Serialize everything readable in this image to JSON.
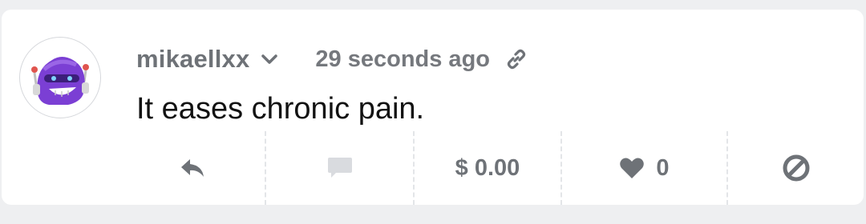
{
  "post": {
    "username": "mikaellxx",
    "timestamp": "29 seconds ago",
    "body": "It eases chronic pain."
  },
  "actions": {
    "tip_amount": "$ 0.00",
    "like_count": "0"
  },
  "icons": {
    "avatar": "purple-robot-avatar",
    "chevron": "chevron-down-icon",
    "link": "link-icon",
    "reply": "reply-icon",
    "comment": "comment-icon",
    "like": "heart-icon",
    "block": "block-icon"
  },
  "colors": {
    "accent_purple": "#7b3fd4",
    "icon_gray": "#6e7277",
    "disabled_gray": "#d9dbdf"
  }
}
